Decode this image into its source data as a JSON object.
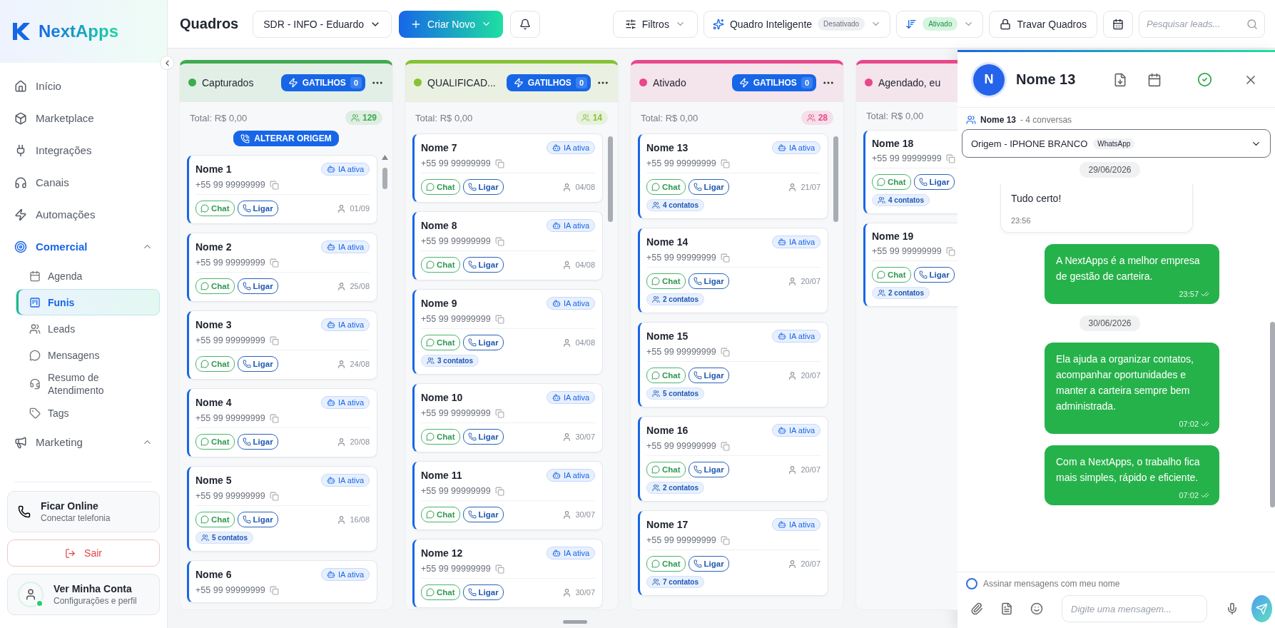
{
  "sidebar": {
    "brand": "NextApps",
    "items": [
      {
        "label": "Início",
        "selected": false
      },
      {
        "label": "Marketplace",
        "selected": false
      },
      {
        "label": "Integrações",
        "selected": false
      },
      {
        "label": "Canais",
        "selected": false
      },
      {
        "label": "Automações",
        "selected": false
      },
      {
        "label": "Comercial",
        "selected": true,
        "expanded": true,
        "children": [
          {
            "label": "Agenda",
            "selected": false
          },
          {
            "label": "Funis",
            "selected": true
          },
          {
            "label": "Leads",
            "selected": false
          },
          {
            "label": "Mensagens",
            "selected": false
          },
          {
            "label": "Resumo de Atendimento",
            "selected": false
          },
          {
            "label": "Tags",
            "selected": false
          }
        ]
      },
      {
        "label": "Marketing",
        "selected": false,
        "expanded": true
      }
    ],
    "online_card": {
      "title": "Ficar Online",
      "subtitle": "Conectar telefonia"
    },
    "logout": "Sair",
    "account": {
      "title": "Ver Minha Conta",
      "subtitle": "Configurações e perfil",
      "online": true
    }
  },
  "toolbar": {
    "title": "Quadros",
    "board_select": "SDR - INFO - Eduardo",
    "create_button": "Criar Novo",
    "filters": "Filtros",
    "smart_board": {
      "label": "Quadro Inteligente",
      "status": "Desativado",
      "on": false
    },
    "sort": {
      "status": "Ativado",
      "on": true
    },
    "lock_button": "Travar Quadros",
    "search": {
      "placeholder": "Pesquisar leads..."
    }
  },
  "columns": [
    {
      "title": "Capturados",
      "color": "#3faa4f",
      "triggers": "GATILHOS",
      "trigger_count": "0",
      "total": "Total: R$ 0,00",
      "count": "129",
      "origin_button": "ALTERAR ORIGEM",
      "cards": [
        {
          "name": "Nome 1",
          "phone": "+55 99 99999999",
          "ia": "IA ativa",
          "chat": "Chat",
          "call": "Ligar",
          "date": "01/09"
        },
        {
          "name": "Nome 2",
          "phone": "+55 99 99999999",
          "ia": "IA ativa",
          "chat": "Chat",
          "call": "Ligar",
          "date": "25/08"
        },
        {
          "name": "Nome 3",
          "phone": "+55 99 99999999",
          "ia": "IA ativa",
          "chat": "Chat",
          "call": "Ligar",
          "date": "24/08"
        },
        {
          "name": "Nome 4",
          "phone": "+55 99 99999999",
          "ia": "IA ativa",
          "chat": "Chat",
          "call": "Ligar",
          "date": "20/08"
        },
        {
          "name": "Nome 5",
          "phone": "+55 99 99999999",
          "ia": "IA ativa",
          "chat": "Chat",
          "call": "Ligar",
          "date": "16/08",
          "contacts": "5 contatos"
        },
        {
          "name": "Nome 6",
          "phone": "+55 99 99999999",
          "ia": "IA ativa"
        }
      ]
    },
    {
      "title": "QUALIFICAD...",
      "color": "#86c232",
      "triggers": "GATILHOS",
      "trigger_count": "0",
      "total": "Total: R$ 0,00",
      "count": "14",
      "cards": [
        {
          "name": "Nome 7",
          "phone": "+55 99 99999999",
          "ia": "IA ativa",
          "chat": "Chat",
          "call": "Ligar",
          "date": "04/08"
        },
        {
          "name": "Nome 8",
          "phone": "+55 99 99999999",
          "ia": "IA ativa",
          "chat": "Chat",
          "call": "Ligar",
          "date": "04/08"
        },
        {
          "name": "Nome 9",
          "phone": "+55 99 99999999",
          "ia": "IA ativa",
          "chat": "Chat",
          "call": "Ligar",
          "date": "04/08",
          "contacts": "3 contatos"
        },
        {
          "name": "Nome 10",
          "phone": "+55 99 99999999",
          "ia": "IA ativa",
          "chat": "Chat",
          "call": "Ligar",
          "date": "30/07"
        },
        {
          "name": "Nome 11",
          "phone": "+55 99 99999999",
          "ia": "IA ativa",
          "chat": "Chat",
          "call": "Ligar",
          "date": "30/07"
        },
        {
          "name": "Nome 12",
          "phone": "+55 99 99999999",
          "ia": "IA ativa",
          "chat": "Chat",
          "call": "Ligar",
          "date": "30/07"
        }
      ]
    },
    {
      "title": "Ativado",
      "color": "#e8478a",
      "triggers": "GATILHOS",
      "trigger_count": "0",
      "total": "Total: R$ 0,00",
      "count": "28",
      "cards": [
        {
          "name": "Nome 13",
          "phone": "+55 99 99999999",
          "ia": "IA ativa",
          "chat": "Chat",
          "call": "Ligar",
          "date": "21/07",
          "contacts": "4 contatos"
        },
        {
          "name": "Nome 14",
          "phone": "+55 99 99999999",
          "ia": "IA ativa",
          "chat": "Chat",
          "call": "Ligar",
          "date": "20/07",
          "contacts": "2 contatos"
        },
        {
          "name": "Nome 15",
          "phone": "+55 99 99999999",
          "ia": "IA ativa",
          "chat": "Chat",
          "call": "Ligar",
          "date": "20/07",
          "contacts": "5 contatos"
        },
        {
          "name": "Nome 16",
          "phone": "+55 99 99999999",
          "ia": "IA ativa",
          "chat": "Chat",
          "call": "Ligar",
          "date": "20/07",
          "contacts": "2 contatos"
        },
        {
          "name": "Nome 17",
          "phone": "+55 99 99999999",
          "ia": "IA ativa",
          "chat": "Chat",
          "call": "Ligar",
          "date": "20/07",
          "contacts": "7 contatos"
        }
      ]
    },
    {
      "title": "Agendado, eu",
      "color": "#e8478a",
      "total": "Total: R$ 0,00",
      "cards": [
        {
          "name": "Nome 18",
          "phone": "+55 99 99999999",
          "chat": "Chat",
          "call": "Ligar",
          "contacts": "4 contatos"
        },
        {
          "name": "Nome 19",
          "phone": "+55 99 99999999",
          "chat": "Chat",
          "call": "Ligar",
          "contacts": "2 contatos"
        }
      ]
    }
  ],
  "chat_panel": {
    "avatar": "N",
    "name": "Nome 13",
    "contact": "Nome 13",
    "conversations": "- 4 conversas",
    "origin": "Origem - IPHONE BRANCO",
    "channel": "WhatsApp",
    "messages": [
      {
        "kind": "date",
        "text": "29/06/2026"
      },
      {
        "kind": "received",
        "text": "Tudo certo!",
        "time": "23:56"
      },
      {
        "kind": "sent",
        "text": "A NextApps é a melhor empresa de gestão de carteira.",
        "time": "23:57"
      },
      {
        "kind": "date",
        "text": "30/06/2026"
      },
      {
        "kind": "sent",
        "text": "Ela ajuda a organizar contatos, acompanhar oportunidades e manter a carteira sempre bem administrada.",
        "time": "07:02"
      },
      {
        "kind": "sent",
        "text": "Com a NextApps, o trabalho fica mais simples, rápido e eficiente.",
        "time": "07:02"
      }
    ],
    "sign_option": {
      "label": "Assinar mensagens com meu nome",
      "checked": false
    },
    "input": {
      "placeholder": "Digite uma mensagem..."
    }
  }
}
